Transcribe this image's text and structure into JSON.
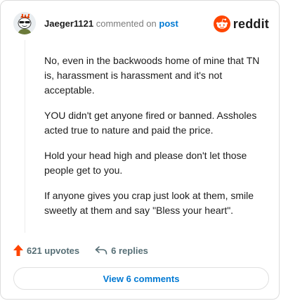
{
  "header": {
    "username": "Jaeger1121",
    "commented_on": "commented on",
    "post_link": "post",
    "brand": "reddit"
  },
  "comment": {
    "paragraphs": [
      "No, even in the backwoods home of mine that TN is, harassment is harassment and it's not acceptable.",
      "YOU didn't get anyone fired or banned. Assholes acted true to nature and paid the price.",
      "Hold your head high and please don't let those people get to you.",
      "If anyone gives you crap just look at them, smile sweetly at them and say \"Bless your heart\"."
    ]
  },
  "actions": {
    "upvotes": "621 upvotes",
    "replies": "6 replies"
  },
  "footer": {
    "view_comments": "View 6 comments"
  },
  "colors": {
    "brand": "#ff4500",
    "link": "#0079d3",
    "upvote": "#ff4500"
  },
  "icons": {
    "avatar": "snoo-avatar-with-sunglasses",
    "brand": "reddit-logo-icon",
    "upvote": "upvote-arrow-icon",
    "reply": "reply-arrow-icon"
  }
}
